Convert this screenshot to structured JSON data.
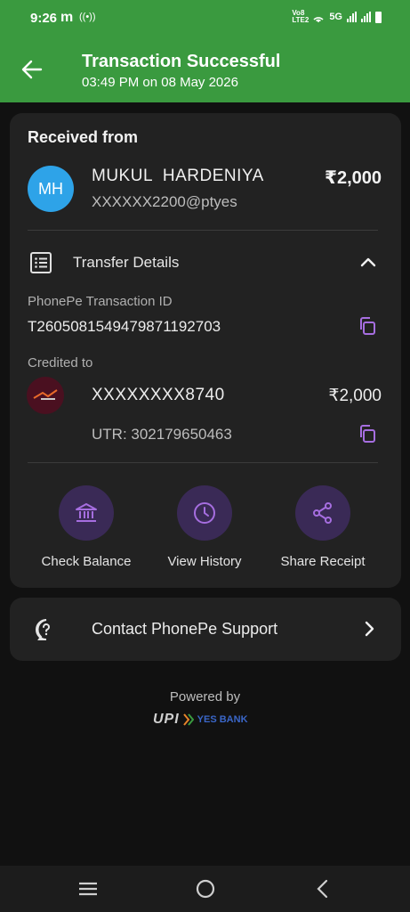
{
  "status_bar": {
    "time": "9:26",
    "app_glyph": "m",
    "radio_glyph": "((•))",
    "network_1": "Vo8 LTE2",
    "network_2": "5G",
    "icons": [
      "signal-icon",
      "wifi-hotspot-icon",
      "battery-icon"
    ]
  },
  "header": {
    "title": "Transaction Successful",
    "subtitle": "03:49 PM on 08 May 2026",
    "back_icon": "arrow-left-icon",
    "color": "#3a9a3f"
  },
  "received": {
    "label": "Received from",
    "initials": "MH",
    "name": "MUKUL  HARDENIYA",
    "vpa": "XXXXXX2200@ptyes",
    "amount": "₹2,000",
    "avatar_color": "#2ea3e8"
  },
  "transfer_details": {
    "label": "Transfer Details",
    "txn_id_label": "PhonePe Transaction ID",
    "txn_id": "T2605081549479871192703",
    "credited_to_label": "Credited to",
    "account": "XXXXXXXX8740",
    "account_amount": "₹2,000",
    "utr": "UTR: 302179650463"
  },
  "actions": [
    {
      "label": "Check Balance",
      "icon": "bank-icon"
    },
    {
      "label": "View History",
      "icon": "clock-icon"
    },
    {
      "label": "Share Receipt",
      "icon": "share-icon"
    }
  ],
  "support": {
    "label": "Contact PhonePe Support",
    "icon": "help-icon"
  },
  "footer": {
    "powered_by": "Powered by",
    "upi_logo": "UPI",
    "bank_logo": "YES BANK"
  },
  "nav": [
    "menu-icon",
    "home-icon",
    "back-icon"
  ],
  "colors": {
    "background": "#111111",
    "card": "#222222",
    "accent_purple": "#a66ee0",
    "action_circle": "#3a2a56"
  }
}
